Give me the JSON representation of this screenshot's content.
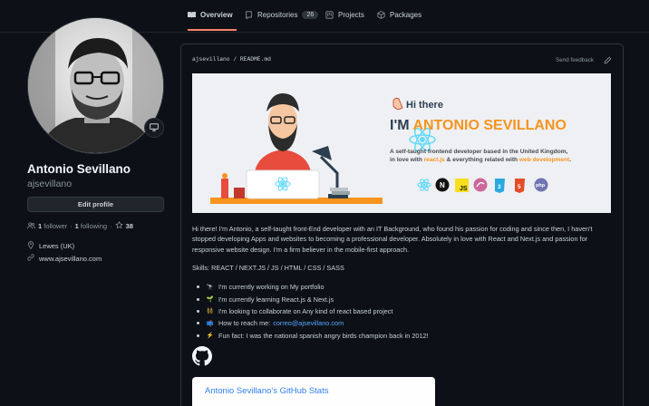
{
  "tabs": [
    {
      "label": "Overview",
      "icon": "book-icon"
    },
    {
      "label": "Repositories",
      "count": "26",
      "icon": "repo-icon"
    },
    {
      "label": "Projects",
      "icon": "project-icon"
    },
    {
      "label": "Packages",
      "icon": "package-icon"
    }
  ],
  "profile": {
    "fullname": "Antonio Sevillano",
    "username": "ajsevillano",
    "edit_label": "Edit profile",
    "followers_count": "1",
    "followers_label": "follower",
    "following_count": "1",
    "following_label": "following",
    "stars_count": "38",
    "location": "Lewes (UK)",
    "website": "www.ajsevillano.com"
  },
  "readme": {
    "path": "ajsevillano / README.md",
    "feedback": "Send feedback",
    "banner": {
      "greeting": "Hi there",
      "name_prefix": "I'M ",
      "name_highlight": "ANTONIO SEVILLANO",
      "line1": "A self-taught frontend developer based in the United Kingdom,",
      "line2_a": "in love with ",
      "line2_b": "react.js",
      "line2_c": " & everything related with ",
      "line2_d": "web development",
      "line2_e": "."
    },
    "intro": "Hi there! I'm Antonio, a self-taught front-End developer with an IT Background, who found his passion for coding and since then, I haven't stopped developing Apps and websites to becoming a professional developer. Absolutely in love with React and Next.js and passion for responsive website design. I'm a firm believer in the mobile-first approach.",
    "skills": "Skills: REACT / NEXT.JS / JS / HTML / CSS / SASS",
    "bullets": [
      {
        "emoji": "🔭",
        "text": "I'm currently working on My portfolio"
      },
      {
        "emoji": "🌱",
        "text": "I'm currently learning React.js & Next.js"
      },
      {
        "emoji": "👯",
        "text": "I'm looking to collaborate on Any kind of react based project"
      },
      {
        "emoji": "📫",
        "text": "How to reach me:",
        "link": "correo@ajsevillano.com"
      },
      {
        "emoji": "⚡",
        "text": "Fun fact: I was the national spanish angry birds champion back in 2012!"
      }
    ],
    "stats_title": "Antonio Sevillano's GitHub Stats"
  },
  "colors": {
    "accent_tab": "#f78166",
    "link": "#58a6ff",
    "banner_orange": "#f7941d",
    "stats_blue": "#2f80ed"
  }
}
